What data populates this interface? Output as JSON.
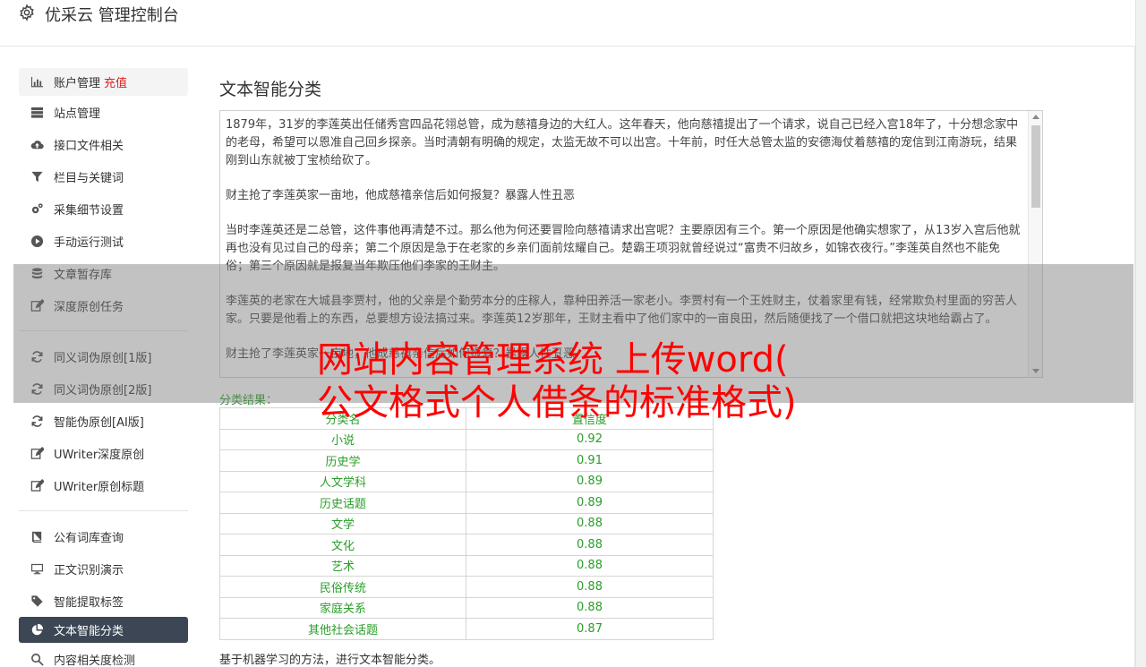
{
  "header": {
    "title": "优采云 管理控制台",
    "icon": "gear-icon"
  },
  "sidebar": {
    "items": [
      {
        "label": "账户管理",
        "extra": "充值",
        "icon": "bar-chart-icon"
      },
      {
        "label": "站点管理",
        "icon": "server-icon"
      },
      {
        "label": "接口文件相关",
        "icon": "cloud-upload-icon"
      },
      {
        "label": "栏目与关键词",
        "icon": "filter-icon"
      },
      {
        "label": "采集细节设置",
        "icon": "cogs-icon"
      },
      {
        "label": "手动运行测试",
        "icon": "play-circle-icon"
      },
      {
        "label": "文章暂存库",
        "icon": "database-icon"
      },
      {
        "label": "深度原创任务",
        "icon": "edit-icon"
      },
      {
        "label": "同义词伪原创[1版]",
        "icon": "refresh-icon"
      },
      {
        "label": "同义词伪原创[2版]",
        "icon": "refresh-icon"
      },
      {
        "label": "智能伪原创[AI版]",
        "icon": "refresh-icon"
      },
      {
        "label": "UWriter深度原创",
        "icon": "edit-icon"
      },
      {
        "label": "UWriter原创标题",
        "icon": "edit-icon"
      },
      {
        "label": "公有词库查询",
        "icon": "book-icon"
      },
      {
        "label": "正文识别演示",
        "icon": "monitor-icon"
      },
      {
        "label": "智能提取标签",
        "icon": "tag-icon"
      },
      {
        "label": "文本智能分类",
        "icon": "pie-chart-icon"
      },
      {
        "label": "内容相关度检测",
        "icon": "search-icon"
      }
    ]
  },
  "main": {
    "title": "文本智能分类",
    "text_paragraphs": [
      "1879年，31岁的李莲英出任储秀宫四品花翎总管，成为慈禧身边的大红人。这年春天，他向慈禧提出了一个请求，说自己已经入宫18年了，十分想念家中的老母，希望可以恩准自己回乡探亲。当时清朝有明确的规定，太监无故不可以出宫。十年前，时任大总管太监的安德海仗着慈禧的宠信到江南游玩，结果刚到山东就被丁宝桢给砍了。",
      "财主抢了李莲英家一亩地，他成慈禧亲信后如何报复？暴露人性丑恶",
      "当时李莲英还是二总管，这件事他再清楚不过。那么他为何还要冒险向慈禧请求出宫呢？主要原因有三个。第一个原因是他确实想家了，从13岁入宫后他就再也没有见过自己的母亲；第二个原因是急于在老家的乡亲们面前炫耀自己。楚霸王项羽就曾经说过“富贵不归故乡，如锦衣夜行。”李莲英自然也不能免俗；第三个原因就是报复当年欺压他们李家的王财主。",
      "李莲英的老家在大城县李贾村，他的父亲是个勤劳本分的庄稼人，靠种田养活一家老小。李贾村有一个王姓财主，仗着家里有钱，经常欺负村里面的穷苦人家。只要是他看上的东西，总要想方设法搞过来。李莲英12岁那年，王财主看中了他们家中的一亩良田，然后随便找了一个借口就把这块地给霸占了。",
      "财主抢了李莲英家一亩地，他成慈禧亲信后如何报复？暴露人性丑恶"
    ],
    "result_label": "分类结果：",
    "table": {
      "headers": [
        "分类名",
        "置信度"
      ],
      "rows": [
        [
          "小说",
          "0.92"
        ],
        [
          "历史学",
          "0.91"
        ],
        [
          "人文学科",
          "0.89"
        ],
        [
          "历史话题",
          "0.89"
        ],
        [
          "文学",
          "0.88"
        ],
        [
          "文化",
          "0.88"
        ],
        [
          "艺术",
          "0.88"
        ],
        [
          "民俗传统",
          "0.88"
        ],
        [
          "家庭关系",
          "0.88"
        ],
        [
          "其他社会话题",
          "0.87"
        ]
      ]
    },
    "footnote": "基于机器学习的方法，进行文本智能分类。"
  },
  "overlay": {
    "line1": "网站内容管理系统 上传word(",
    "line2": "公文格式个人借条的标准格式)"
  },
  "colors": {
    "accent_green": "#2a9d2a",
    "active_nav": "#3c4654",
    "recharge_red": "#e02020",
    "overlay_red": "#ff0000"
  }
}
